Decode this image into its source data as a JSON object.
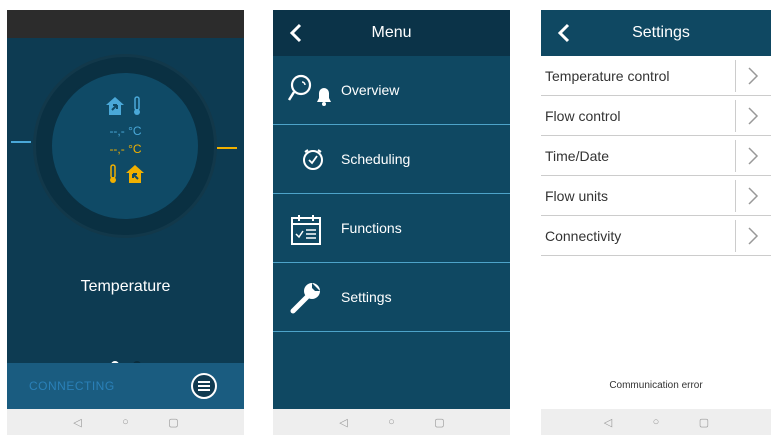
{
  "screen1": {
    "blue_temp": "--,- °C",
    "orange_temp": "--,- °C",
    "title": "Temperature",
    "status": "CONNECTING",
    "icons": [
      "house-inflow-icon",
      "thermometer-icon",
      "thermometer-icon",
      "house-outflow-icon",
      "menu-icon"
    ],
    "colors": {
      "blue": "#4aa8d8",
      "orange": "#f0b000",
      "background": "#0d3b52"
    },
    "carousel": {
      "page": 1,
      "pages": 2
    }
  },
  "screen2": {
    "title": "Menu",
    "items": [
      {
        "label": "Overview",
        "icon": "overview-icon"
      },
      {
        "label": "Scheduling",
        "icon": "clock-icon"
      },
      {
        "label": "Functions",
        "icon": "calendar-icon"
      },
      {
        "label": "Settings",
        "icon": "wrench-icon"
      }
    ]
  },
  "screen3": {
    "title": "Settings",
    "items": [
      {
        "label": "Temperature control"
      },
      {
        "label": "Flow control"
      },
      {
        "label": "Time/Date"
      },
      {
        "label": "Flow units"
      },
      {
        "label": "Connectivity"
      }
    ],
    "message": "Communication error"
  },
  "navbar": {
    "back": "◁",
    "home": "○",
    "recents": "▢"
  }
}
